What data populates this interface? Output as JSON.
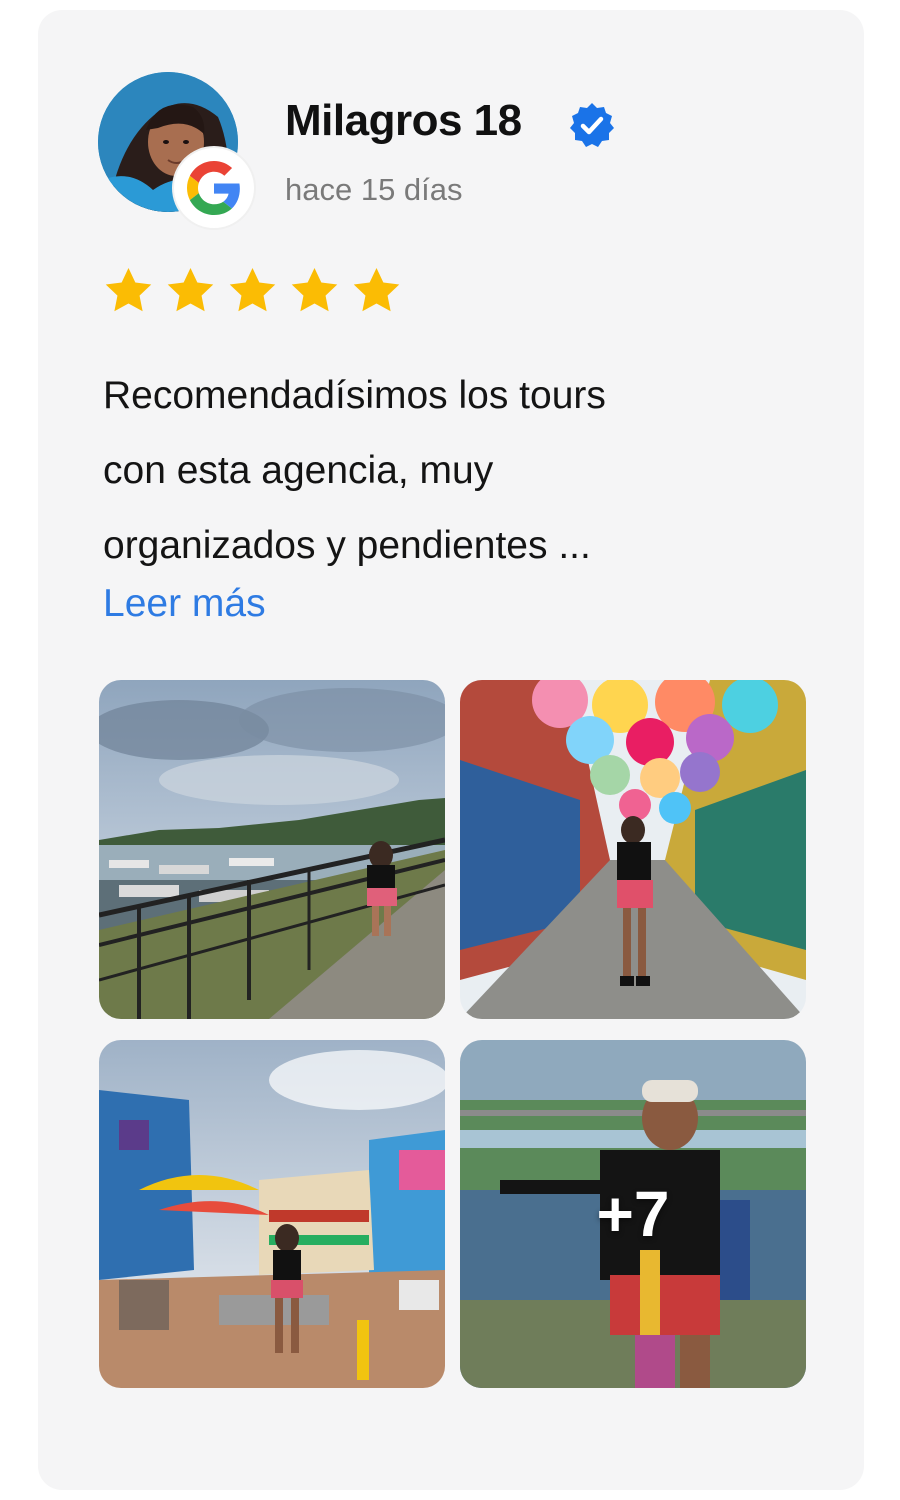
{
  "review": {
    "author": "Milagros 18",
    "time_ago": "hace 15 días",
    "rating": 5,
    "rating_max": 5,
    "text": "Recomendadísimos los tours\ncon esta agencia, muy\norganizados y pendientes ...",
    "read_more_label": "Leer más",
    "source_icon": "google-g-icon",
    "verified_icon": "verified-badge-icon",
    "photos": [
      {
        "icon": "lake-dock-photo"
      },
      {
        "icon": "umbrella-street-photo"
      },
      {
        "icon": "colorful-plaza-photo"
      },
      {
        "icon": "viewpoint-photo",
        "more_count_label": "+7"
      }
    ]
  },
  "colors": {
    "card_background": "#f5f5f6",
    "star": "#fbbc04",
    "link": "#2e7be3",
    "verified": "#1a73e8",
    "time_text": "#7a7a7a"
  }
}
